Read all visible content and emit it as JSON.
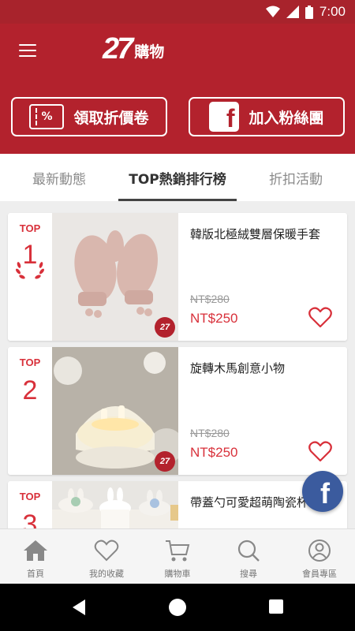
{
  "status_bar": {
    "time": "7:00"
  },
  "header": {
    "logo_number": "27",
    "logo_text": "購物",
    "coupon_button": "領取折價卷",
    "coupon_icon_text": "%",
    "fans_button": "加入粉絲團",
    "fb_icon_text": "f"
  },
  "tabs": [
    {
      "label": "最新動態",
      "active": false
    },
    {
      "label": "TOP熱銷排行榜",
      "active": true
    },
    {
      "label": "折扣活動",
      "active": false
    }
  ],
  "products": [
    {
      "rank_label": "TOP",
      "rank": "1",
      "name": "韓版北極絨雙層保暖手套",
      "old_price": "NT$280",
      "price": "NT$250",
      "badge": "27"
    },
    {
      "rank_label": "TOP",
      "rank": "2",
      "name": "旋轉木馬創意小物",
      "old_price": "NT$280",
      "price": "NT$250",
      "badge": "27"
    },
    {
      "rank_label": "TOP",
      "rank": "3",
      "name": "帶蓋勺可愛超萌陶瓷杯",
      "old_price": "",
      "price": "",
      "badge": ""
    }
  ],
  "floating_fb": "f",
  "bottom_nav": [
    {
      "label": "首頁",
      "icon": "home-icon"
    },
    {
      "label": "我的收藏",
      "icon": "heart-icon"
    },
    {
      "label": "購物車",
      "icon": "cart-icon"
    },
    {
      "label": "搜尋",
      "icon": "search-icon"
    },
    {
      "label": "會員專區",
      "icon": "user-icon"
    }
  ],
  "colors": {
    "brand": "#b3222d",
    "accent": "#d8303a",
    "facebook": "#3b5b9e"
  }
}
